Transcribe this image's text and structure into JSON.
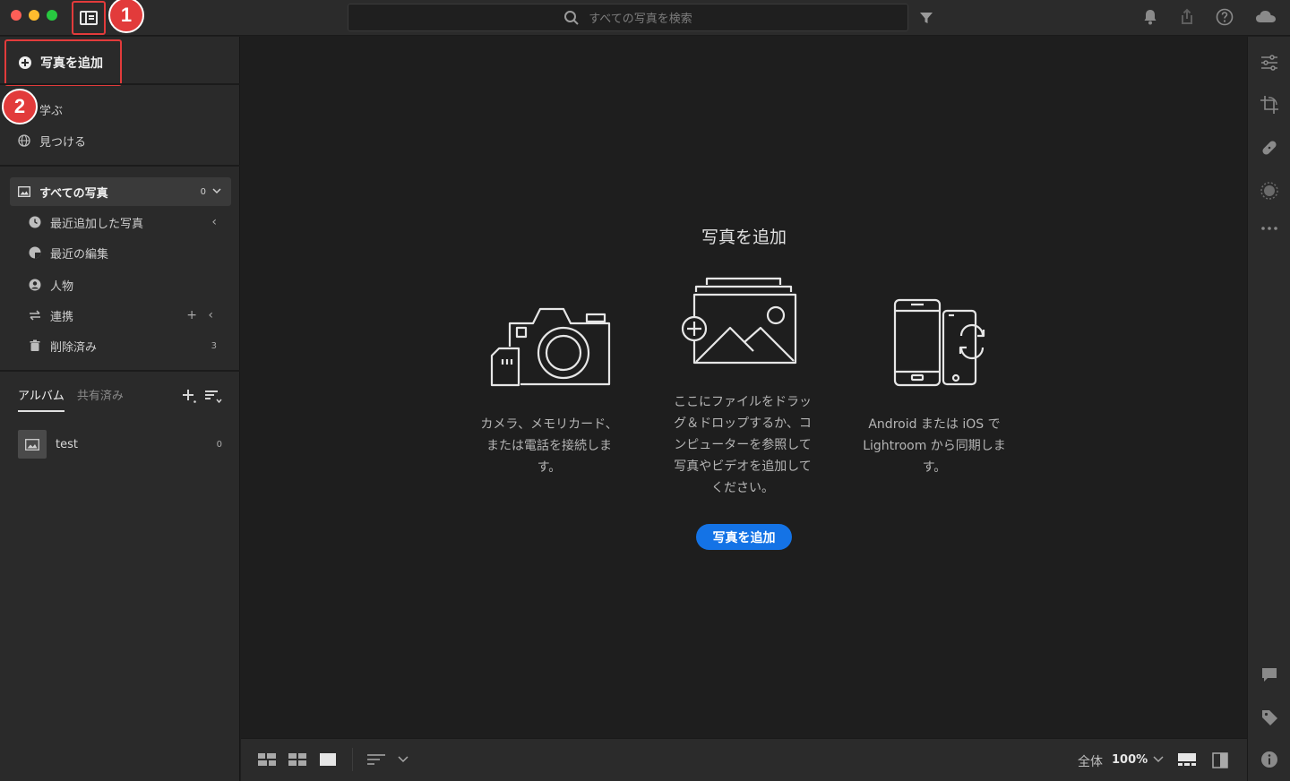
{
  "titlebar": {
    "search_placeholder": "すべての写真を検索",
    "annotations": [
      "1",
      "2"
    ]
  },
  "sidebar": {
    "add_photo_label": "写真を追加",
    "learn_label": "学ぶ",
    "discover_label": "見つける",
    "all_photos": {
      "label": "すべての写真",
      "count": "0"
    },
    "items": [
      {
        "label": "最近追加した写真",
        "icon": "clock-icon",
        "right": "‹"
      },
      {
        "label": "最近の編集",
        "icon": "recent-edit-icon",
        "right": ""
      },
      {
        "label": "人物",
        "icon": "person-icon",
        "right": ""
      },
      {
        "label": "連携",
        "icon": "sync-arrows-icon",
        "right": "+ ‹"
      },
      {
        "label": "削除済み",
        "icon": "trash-icon",
        "right": "3"
      }
    ],
    "tabs": [
      {
        "label": "アルバム",
        "active": true
      },
      {
        "label": "共有済み",
        "active": false
      }
    ],
    "albums": [
      {
        "name": "test",
        "count": "0"
      }
    ]
  },
  "main": {
    "title": "写真を追加",
    "features": [
      {
        "icon": "camera-icon",
        "text_lines": [
          "カメラ、メモリカード、",
          "または電話を接続しま",
          "す。"
        ]
      },
      {
        "icon": "add-image-icon",
        "text_lines": [
          "ここにファイルをドラッ",
          "グ＆ドロップするか、コ",
          "ンピューターを参照して",
          "写真やビデオを追加して",
          "ください。"
        ]
      },
      {
        "icon": "mobile-sync-icon",
        "text_lines": [
          "Android または iOS で",
          "Lightroom から同期しま",
          "す。"
        ]
      }
    ],
    "cta_label": "写真を追加"
  },
  "bottombar": {
    "zoom_scope": "全体",
    "zoom_value": "100%"
  },
  "colors": {
    "accent": "#1473e6",
    "annotation": "#e23b3b",
    "background": "#1e1e1e",
    "panel": "#2a2a2a"
  }
}
